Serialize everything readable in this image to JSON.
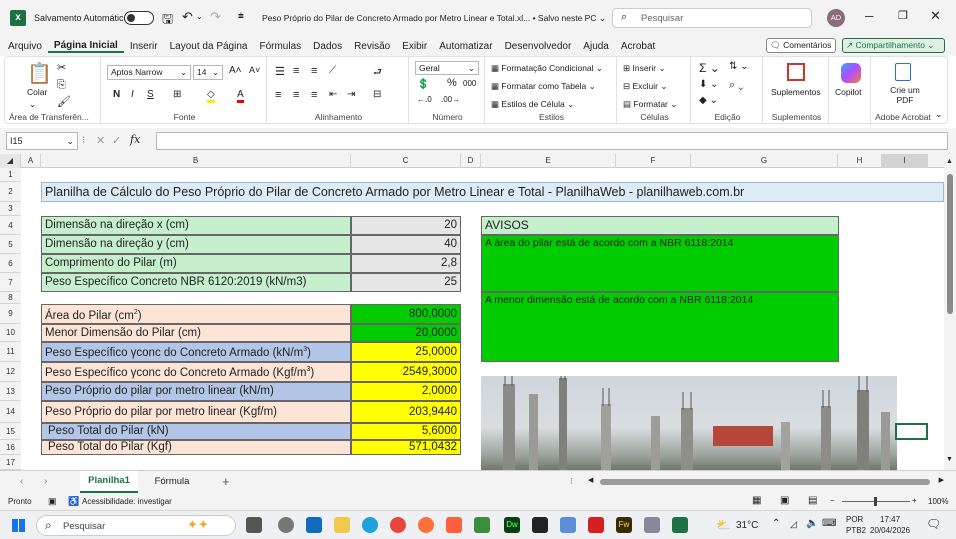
{
  "titlebar": {
    "autosave_label": "Salvamento Automático",
    "doc_title": "Peso Próprio do Pilar de Concreto Armado por Metro Linear e Total.xl... • Salvo neste PC ⌄",
    "search_placeholder": "Pesquisar",
    "avatar": "AD"
  },
  "ribbon_tabs": [
    "Arquivo",
    "Página Inicial",
    "Inserir",
    "Layout da Página",
    "Fórmulas",
    "Dados",
    "Revisão",
    "Exibir",
    "Automatizar",
    "Desenvolvedor",
    "Ajuda",
    "Acrobat"
  ],
  "ribbon_right": {
    "comments": "Comentários",
    "share": "Compartilhamento"
  },
  "ribbon": {
    "clipboard": {
      "paste": "Colar",
      "label": "Área de Transferên..."
    },
    "font": {
      "name": "Aptos Narrow",
      "size": "14",
      "label": "Fonte"
    },
    "alignment": {
      "label": "Alinhamento"
    },
    "number": {
      "format": "Geral",
      "label": "Número"
    },
    "styles": {
      "cond": "Formatação Condicional",
      "table": "Formatar como Tabela",
      "cell": "Estilos de Célula",
      "label": "Estilos"
    },
    "cells": {
      "insert": "Inserir",
      "delete": "Excluir",
      "format": "Formatar",
      "label": "Células"
    },
    "editing": {
      "label": "Edição"
    },
    "addins": {
      "name": "Suplementos",
      "label": "Suplementos"
    },
    "copilot": {
      "name": "Copilot"
    },
    "acrobat": {
      "name": "Crie um PDF",
      "label": "Adobe Acrobat"
    }
  },
  "formula_bar": {
    "cell_ref": "I15",
    "formula": ""
  },
  "columns": [
    "A",
    "B",
    "C",
    "D",
    "E",
    "F",
    "G",
    "H",
    "I"
  ],
  "rows": [
    "1",
    "2",
    "3",
    "4",
    "5",
    "6",
    "7",
    "8",
    "9",
    "10",
    "11",
    "12",
    "13",
    "14",
    "15",
    "16",
    "17"
  ],
  "sheet": {
    "title": "Planilha de Cálculo do Peso Próprio do Pilar de Concreto Armado por Metro Linear e Total - PlanilhaWeb - planilhaweb.com.br",
    "inputs": [
      {
        "label": "Dimensão na direção x (cm)",
        "value": "20"
      },
      {
        "label": "Dimensão na direção y (cm)",
        "value": "40"
      },
      {
        "label": "Comprimento do Pilar (m)",
        "value": "2,8"
      },
      {
        "label": "Peso Específico Concreto NBR 6120:2019 (kN/m3)",
        "value": "25"
      }
    ],
    "results": [
      {
        "label": "Área do Pilar (cm",
        "sup": "2",
        "tail": ")",
        "value": "800,0000"
      },
      {
        "label": "Menor Dimensão do Pilar (cm)",
        "sup": "",
        "tail": "",
        "value": "20,0000"
      },
      {
        "label": "Peso Específico γconc do Concreto Armado (kN/m",
        "sup": "3",
        "tail": ")",
        "value": "25,0000"
      },
      {
        "label": "Peso Específico γconc do Concreto Armado (Kgf/m",
        "sup": "3",
        "tail": ")",
        "value": "2549,3000"
      },
      {
        "label": "Peso Próprio do pilar por metro linear (kN/m)",
        "sup": "",
        "tail": "",
        "value": "2,0000"
      },
      {
        "label": "Peso Próprio do pilar por metro linear (Kgf/m)",
        "sup": "",
        "tail": "",
        "value": "203,9440"
      },
      {
        "label": "Peso Total do Pilar (kN)",
        "sup": "",
        "tail": "",
        "value": "5,6000"
      },
      {
        "label": "Peso Total do Pilar (Kgf)",
        "sup": "",
        "tail": "",
        "value": "571,0432"
      }
    ],
    "avisos": {
      "title": "AVISOS",
      "msg1": "A área do pilar está de acordo com a NBR 6118:2014",
      "msg2": "A menor dimensão está de acordo com a NBR 6118:2014"
    }
  },
  "sheet_tabs": [
    "Planilha1",
    "Fórmula"
  ],
  "status": {
    "ready": "Pronto",
    "accessibility": "Acessibilidade: investigar",
    "zoom": "100%"
  },
  "taskbar": {
    "search": "Pesquisar",
    "temp": "31°C",
    "lang": "POR",
    "layout": "PTB2",
    "time": "17:47",
    "date": "20/04/2026"
  },
  "colors": {
    "green_input": "#c6efce",
    "gray_value": "#e7e6e6",
    "peach": "#fce4d6",
    "blue": "#b4c6e7",
    "yellow": "#ffff00",
    "bright_green": "#00cc00",
    "excel_green": "#1e7145"
  }
}
